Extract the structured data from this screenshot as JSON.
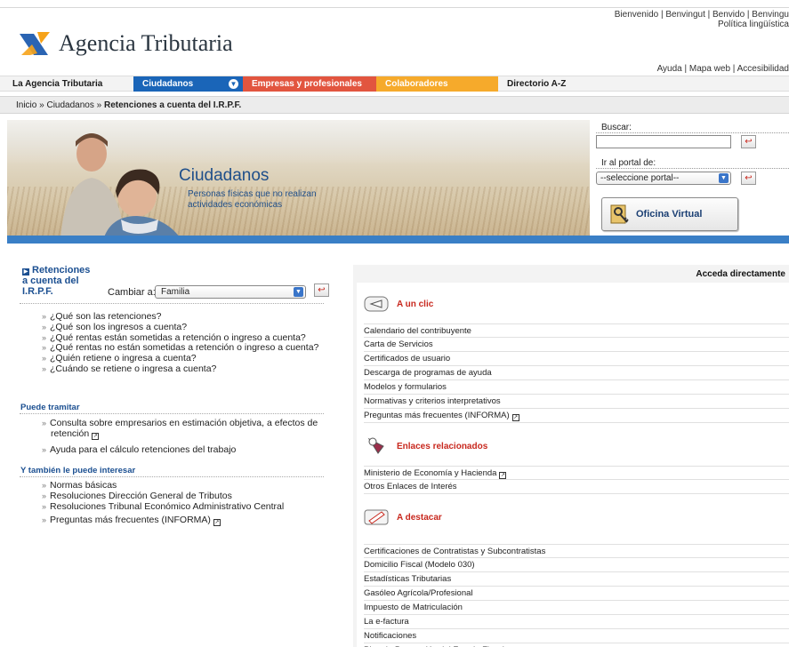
{
  "header": {
    "welcome_line1": "Bienvenido | Benvingut | Benvido | Benvingu",
    "welcome_line2": "Política lingüística",
    "logo_text": "Agencia Tributaria",
    "top_links": "Ayuda | Mapa web | Accesibilidad"
  },
  "nav": {
    "tabs": [
      {
        "label": "La Agencia Tributaria"
      },
      {
        "label": "Ciudadanos"
      },
      {
        "label": "Empresas y profesionales"
      },
      {
        "label": "Colaboradores"
      },
      {
        "label": "Directorio A-Z"
      }
    ]
  },
  "breadcrumb": {
    "home": "Inicio",
    "section": "Ciudadanos",
    "current": "Retenciones a cuenta del I.R.P.F.",
    "sep": "»"
  },
  "hero": {
    "title": "Ciudadanos",
    "subtitle_line1": "Personas físicas que no realizan",
    "subtitle_line2": "actividades económicas"
  },
  "side": {
    "search_label": "Buscar:",
    "search_value": "",
    "portal_label": "Ir al portal de:",
    "portal_value": "--seleccione portal--",
    "office_button": "Oficina Virtual"
  },
  "left": {
    "title_line1": "Retenciones",
    "title_line2": "a cuenta del",
    "title_line3": "I.R.P.F.",
    "change_label": "Cambiar a:",
    "change_value": "Familia",
    "questions": [
      "¿Qué son las retenciones?",
      "¿Qué son los ingresos a cuenta?",
      "¿Qué rentas están sometidas a retención o ingreso a cuenta?",
      "¿Qué rentas no están sometidas a retención o ingreso a cuenta?",
      "¿Quién retiene o ingresa a cuenta?",
      "¿Cuándo se retiene o ingresa a cuenta?"
    ],
    "tramitar_title": "Puede tramitar",
    "tramitar": [
      "Consulta sobre empresarios en estimación objetiva, a efectos de",
      "retención",
      "Ayuda para el cálculo retenciones del trabajo"
    ],
    "interes_title": "Y también le puede interesar",
    "interes": [
      "Normas básicas",
      "Resoluciones Dirección General de Tributos",
      "Resoluciones Tribunal Económico Administrativo Central",
      "Preguntas más frecuentes (INFORMA)"
    ]
  },
  "right": {
    "heading": "Acceda directamente",
    "groups": [
      {
        "label": "A un clic",
        "links": [
          "Calendario del contribuyente",
          "Carta de Servicios",
          "Certificados de usuario",
          "Descarga de programas de ayuda",
          "Modelos y formularios",
          "Normativas y criterios interpretativos",
          "Preguntas más frecuentes (INFORMA)"
        ]
      },
      {
        "label": "Enlaces relacionados",
        "links": [
          "Ministerio de Economía y Hacienda",
          "Otros Enlaces de Interés"
        ]
      },
      {
        "label": "A destacar",
        "links": [
          "Certificaciones de Contratistas y Subcontratistas",
          "Domicilio Fiscal (Modelo 030)",
          "Estadísticas Tributarias",
          "Gasóleo Agrícola/Profesional",
          "Impuesto de Matriculación",
          "La e-factura",
          "Notificaciones",
          "Plan de Prevención del Fraude Fiscal"
        ]
      }
    ]
  },
  "colors": {
    "nav_ciudadanos": "#1a65b8",
    "nav_empresas": "#e2553f",
    "nav_colaboradores": "#f6aa2b",
    "accent_red": "#c8281e",
    "title_blue": "#1b4f91"
  }
}
